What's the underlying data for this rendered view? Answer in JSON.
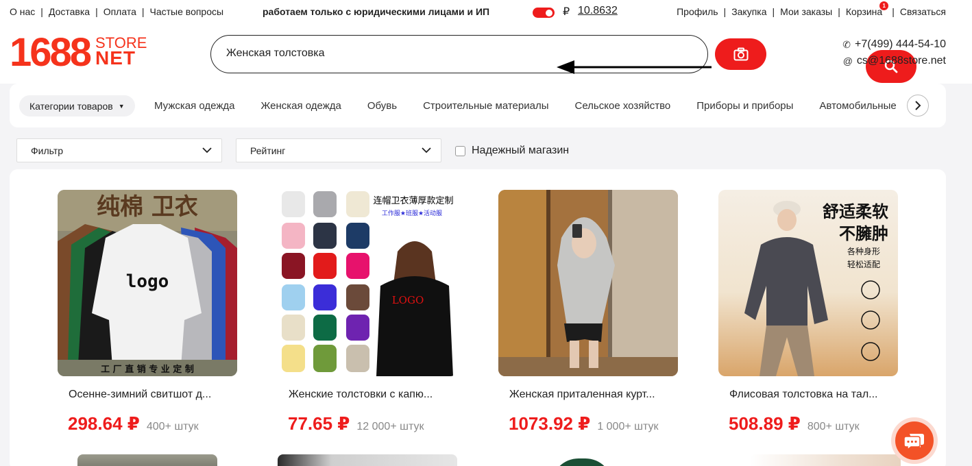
{
  "topbar": {
    "links_left": [
      "О нас",
      "Доставка",
      "Оплата",
      "Частые вопросы"
    ],
    "notice": "работаем только с юридическими лицами и ИП",
    "currency_symbol": "₽",
    "rate": "10.8632",
    "links_right": [
      "Профиль",
      "Закупка",
      "Мои заказы",
      "Корзина",
      "Связаться"
    ],
    "cart_count": "1"
  },
  "logo": {
    "number": "1688",
    "store": "STORE",
    "net": "NET"
  },
  "search": {
    "value": "Женская толстовка"
  },
  "contacts": {
    "phone": "+7(499) 444-54-10",
    "email": "cs@1688store.net"
  },
  "categories": {
    "all_label": "Категории товаров",
    "items": [
      "Мужская одежда",
      "Женская одежда",
      "Обувь",
      "Строительные материалы",
      "Сельское хозяйство",
      "Приборы и приборы",
      "Автомобильные"
    ]
  },
  "filters": {
    "filter_label": "Фильтр",
    "rating_label": "Рейтинг",
    "reliable_label": "Надежный магазин",
    "reliable_checked": false
  },
  "products": [
    {
      "name": "Осенне-зимний свитшот д...",
      "price": "298.64 ₽",
      "qty": "400+ штук",
      "img_title": "纯棉  卫衣",
      "img_logo": "logo",
      "img_footer": "工 厂 直 销      专 业 定 制"
    },
    {
      "name": "Женские толстовки с капю...",
      "price": "77.65 ₽",
      "qty": "12 000+ штук",
      "img_title": "连帽卫衣薄厚款定制",
      "img_sub": "工作服★班服★活动服",
      "img_logo": "LOGO"
    },
    {
      "name": "Женская приталенная курт...",
      "price": "1073.92 ₽",
      "qty": "1 000+ штук"
    },
    {
      "name": "Флисовая толстовка на тал...",
      "price": "508.89 ₽",
      "qty": "800+ штук",
      "img_line1": "舒适柔软",
      "img_line2": "不臃肿",
      "img_line3": "各种身形",
      "img_line4": "轻松适配"
    }
  ],
  "colors": {
    "accent": "#ee1c1c",
    "brand": "#f5331c",
    "chat": "#f35227"
  }
}
